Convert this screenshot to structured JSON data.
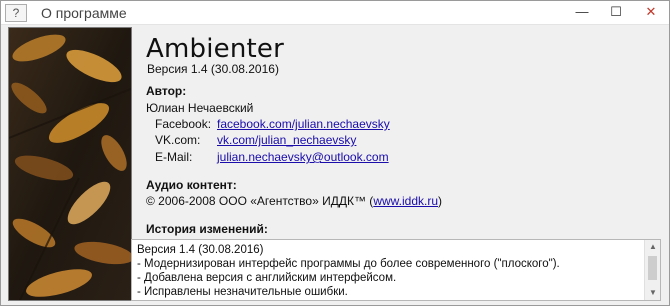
{
  "window": {
    "title": "О программе",
    "help_label": "?",
    "minimize_label": "—",
    "maximize_label": "☐",
    "close_label": "✕"
  },
  "app": {
    "name": "Ambienter",
    "version": "Версия 1.4 (30.08.2016)"
  },
  "author": {
    "title": "Автор:",
    "name": "Юлиан Нечаевский",
    "rows": [
      {
        "label": "Facebook:",
        "link": "facebook.com/julian.nechaevsky"
      },
      {
        "label": "VK.com:",
        "link": "vk.com/julian_nechaevsky"
      },
      {
        "label": "E-Mail:",
        "link": "julian.nechaevsky@outlook.com"
      }
    ]
  },
  "audio": {
    "title": "Аудио контент:",
    "prefix": "© 2006-2008 ООО «Агентство» ИДДК™ (",
    "link": "www.iddk.ru",
    "suffix": ")"
  },
  "history": {
    "title": "История изменений:",
    "text": "Версия 1.4 (30.08.2016)\n- Модернизирован интерфейс программы до более современного (\"плоского\").\n- Добавлена версия с английским интерфейсом.\n- Исправлены незначительные ошибки."
  },
  "icons": {
    "scroll_up": "▲",
    "scroll_down": "▼"
  },
  "colors": {
    "link": "#1a0dab",
    "photo_leaf": "#c9892a"
  }
}
